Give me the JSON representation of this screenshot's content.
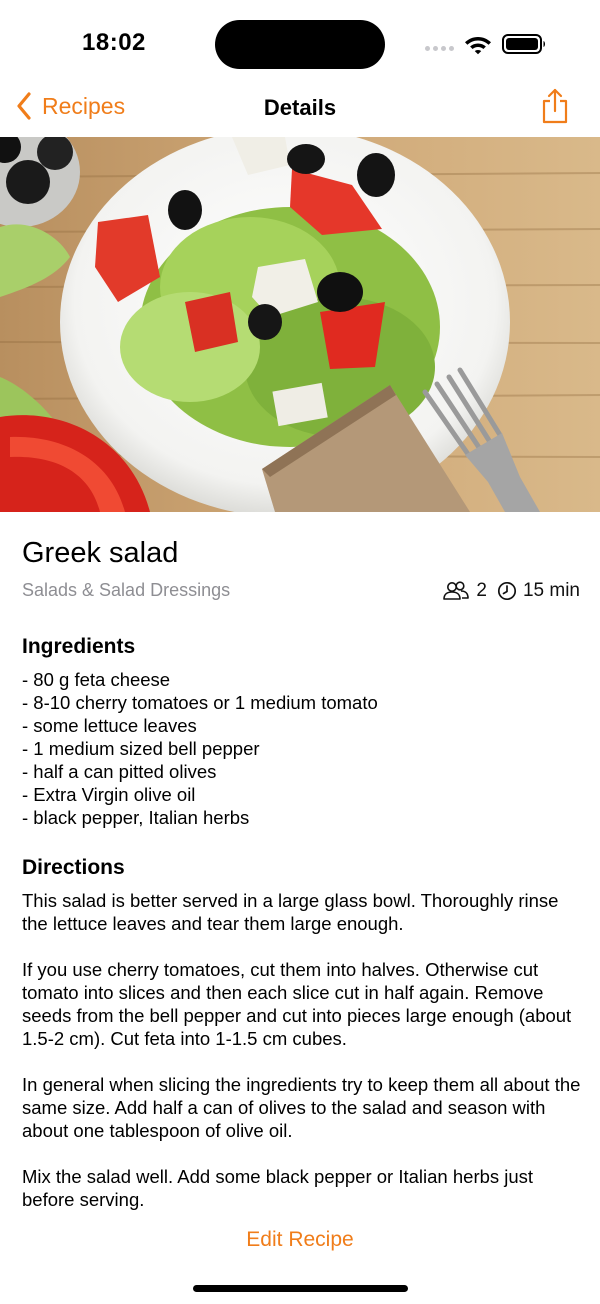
{
  "status_bar": {
    "time": "18:02"
  },
  "nav": {
    "back_label": "Recipes",
    "title": "Details"
  },
  "recipe": {
    "title": "Greek salad",
    "category": "Salads & Salad Dressings",
    "servings": "2",
    "time": "15 min",
    "ingredients_heading": "Ingredients",
    "ingredients": [
      "- 80 g feta cheese",
      "- 8-10 cherry tomatoes or 1 medium tomato",
      "- some lettuce leaves",
      "- 1 medium sized bell pepper",
      "- half a can pitted olives",
      "- Extra Virgin olive oil",
      "- black pepper, Italian herbs"
    ],
    "directions_heading": "Directions",
    "directions": [
      "This salad is better served in a large glass bowl. Thoroughly rinse the lettuce leaves and tear them large enough.",
      "If you use cherry tomatoes, cut them into halves. Otherwise cut tomato into slices and then each slice cut in half again. Remove seeds from the bell pepper and cut into pieces large enough (about 1.5-2 cm). Cut feta into 1-1.5 cm cubes.",
      "In general when slicing the ingredients try to keep them all about the same size. Add half a can of olives to the salad and season with about one tablespoon of olive oil.",
      "Mix the salad well. Add some black pepper or Italian herbs just before serving."
    ]
  },
  "actions": {
    "edit_label": "Edit Recipe"
  },
  "colors": {
    "accent": "#f07d1a",
    "secondary_text": "#8e8e93"
  },
  "icons": {
    "back": "chevron-left-icon",
    "share": "share-icon",
    "servings": "people-icon",
    "time": "clock-icon"
  }
}
